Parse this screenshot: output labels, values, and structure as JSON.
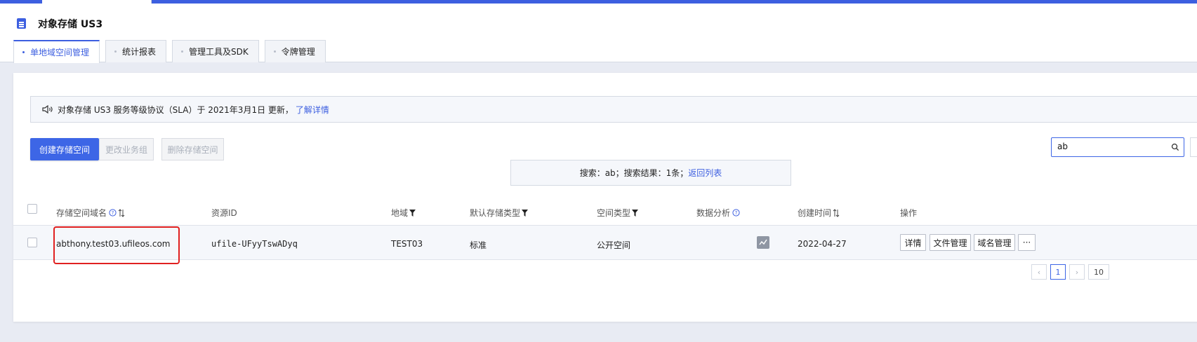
{
  "header": {
    "title": "对象存储 US3",
    "tabs": [
      {
        "label": "单地域空间管理",
        "active": true
      },
      {
        "label": "统计报表",
        "active": false
      },
      {
        "label": "管理工具及SDK",
        "active": false
      },
      {
        "label": "令牌管理",
        "active": false
      }
    ]
  },
  "notice": {
    "text": "对象存储 US3 服务等级协议（SLA）于 2021年3月1日 更新，",
    "link": "了解详情"
  },
  "toolbar": {
    "create_label": "创建存储空间",
    "change_group_label": "更改业务组",
    "delete_label": "删除存储空间",
    "search_value": "ab"
  },
  "search_result": {
    "text": "搜索：ab；搜索结果：1条；",
    "link": "返回列表"
  },
  "table": {
    "headers": [
      "存储空间域名",
      "资源ID",
      "地域",
      "默认存储类型",
      "空间类型",
      "数据分析",
      "创建时间",
      "操作"
    ],
    "rows": [
      {
        "domain": "abthony.test03.ufileos.com",
        "resource_id": "ufile-UFyyTswADyq",
        "region": "TEST03",
        "storage_type": "标准",
        "space_type": "公开空间",
        "created": "2022-04-27",
        "actions": [
          "详情",
          "文件管理",
          "域名管理",
          "···"
        ]
      }
    ]
  },
  "pagination": {
    "prev": "‹",
    "current": "1",
    "next": "›",
    "page_size": "10"
  },
  "colors": {
    "accent": "#3d5fe0",
    "highlight": "#e02020"
  }
}
